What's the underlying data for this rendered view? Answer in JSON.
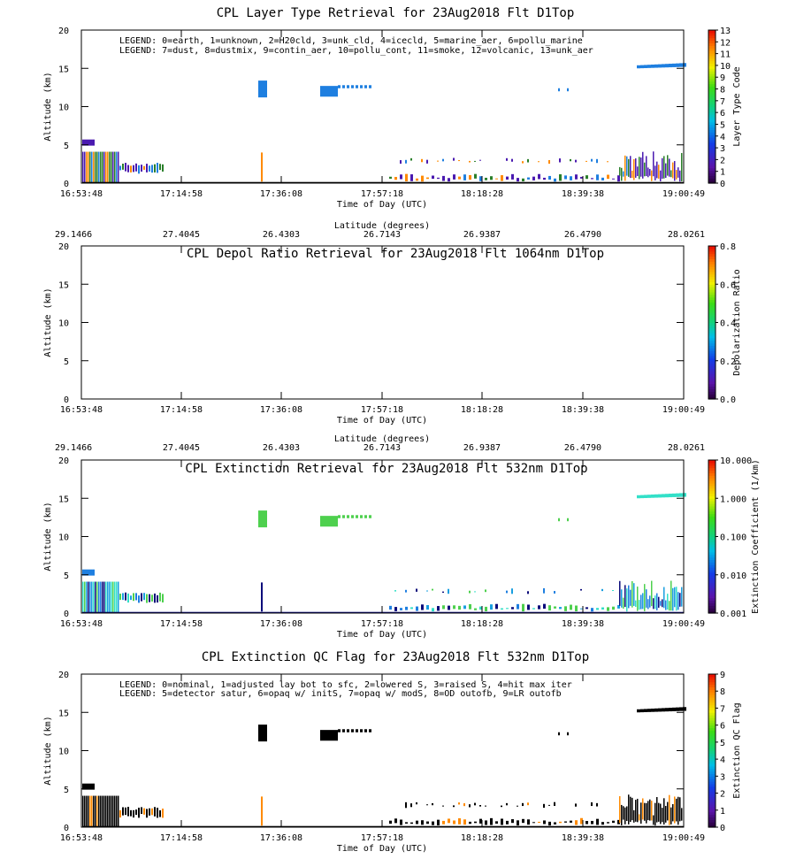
{
  "chart_data": [
    {
      "type": "heatmap",
      "title": "CPL Layer Type Retrieval for 23Aug2018 Flt D1Top",
      "xlabel": "Time of Day (UTC)",
      "ylabel": "Altitude (km)",
      "x_ticks": [
        "16:53:48",
        "17:14:58",
        "17:36:08",
        "17:57:18",
        "18:18:28",
        "18:39:38",
        "19:00:49"
      ],
      "y_ticks": [
        "0",
        "5",
        "10",
        "15",
        "20"
      ],
      "ylim": [
        0,
        20
      ],
      "legend_lines": [
        "LEGEND: 0=earth, 1=unknown, 2=H20cld, 3=unk_cld, 4=icecld, 5=marine_aer, 6=pollu_marine",
        "LEGEND: 7=dust, 8=dustmix, 9=contin_aer, 10=pollu_cont, 11=smoke, 12=volcanic, 13=unk_aer"
      ],
      "colorbar": {
        "label": "Layer Type Code",
        "ticks": [
          "0",
          "1",
          "2",
          "3",
          "4",
          "5",
          "6",
          "7",
          "8",
          "9",
          "10",
          "11",
          "12",
          "13"
        ],
        "range": [
          0,
          13
        ]
      }
    },
    {
      "type": "heatmap",
      "title": "CPL Depol Ratio Retrieval for 23Aug2018 Flt 1064nm D1Top",
      "xlabel": "Time of Day (UTC)",
      "ylabel": "Altitude (km)",
      "top_axis_label": "Latitude (degrees)",
      "top_ticks": [
        "29.1466",
        "27.4045",
        "26.4303",
        "26.7143",
        "26.9387",
        "26.4790",
        "28.0261"
      ],
      "x_ticks": [
        "16:53:48",
        "17:14:58",
        "17:36:08",
        "17:57:18",
        "18:18:28",
        "18:39:38",
        "19:00:49"
      ],
      "y_ticks": [
        "0",
        "5",
        "10",
        "15",
        "20"
      ],
      "ylim": [
        0,
        20
      ],
      "colorbar": {
        "label": "Depolarization Ratio",
        "ticks": [
          "0.0",
          "0.2",
          "0.4",
          "0.6",
          "0.8"
        ],
        "range": [
          0,
          0.8
        ]
      }
    },
    {
      "type": "heatmap",
      "title": "CPL Extinction Retrieval for 23Aug2018 Flt 532nm D1Top",
      "xlabel": "Time of Day (UTC)",
      "ylabel": "Altitude (km)",
      "top_axis_label": "Latitude (degrees)",
      "top_ticks": [
        "29.1466",
        "27.4045",
        "26.4303",
        "26.7143",
        "26.9387",
        "26.4790",
        "28.0261"
      ],
      "x_ticks": [
        "16:53:48",
        "17:14:58",
        "17:36:08",
        "17:57:18",
        "18:18:28",
        "18:39:38",
        "19:00:49"
      ],
      "y_ticks": [
        "0",
        "5",
        "10",
        "15",
        "20"
      ],
      "ylim": [
        0,
        20
      ],
      "colorbar": {
        "label": "Extinction Coefficient (1/km)",
        "ticks": [
          "0.001",
          "0.010",
          "0.100",
          "1.000",
          "10.000"
        ],
        "range": [
          0.001,
          10
        ],
        "scale": "log"
      }
    },
    {
      "type": "heatmap",
      "title": "CPL Extinction QC Flag for 23Aug2018 Flt 532nm D1Top",
      "xlabel": "Time of Day (UTC)",
      "ylabel": "Altitude (km)",
      "x_ticks": [
        "16:53:48",
        "17:14:58",
        "17:36:08",
        "17:57:18",
        "18:18:28",
        "18:39:38",
        "19:00:49"
      ],
      "y_ticks": [
        "0",
        "5",
        "10",
        "15",
        "20"
      ],
      "ylim": [
        0,
        20
      ],
      "legend_lines": [
        "LEGEND: 0=nominal, 1=adjusted lay bot to sfc, 2=lowered S, 3=raised S, 4=hit max iter",
        "LEGEND: 5=detector satur, 6=opaq w/ initS, 7=opaq w/ modS, 8=OD outofb, 9=LR outofb"
      ],
      "colorbar": {
        "label": "Extinction QC Flag",
        "ticks": [
          "0",
          "1",
          "2",
          "3",
          "4",
          "5",
          "6",
          "7",
          "8",
          "9"
        ],
        "range": [
          0,
          9
        ]
      }
    }
  ],
  "colors": {
    "cloud_blue": "#1e7fe0",
    "cloud_green": "#4ed04e",
    "cyan": "#33e0c8",
    "purple": "#4a1ab0",
    "navy": "#0a0a7a",
    "orange": "#ff8a00",
    "dark": "#000000"
  }
}
